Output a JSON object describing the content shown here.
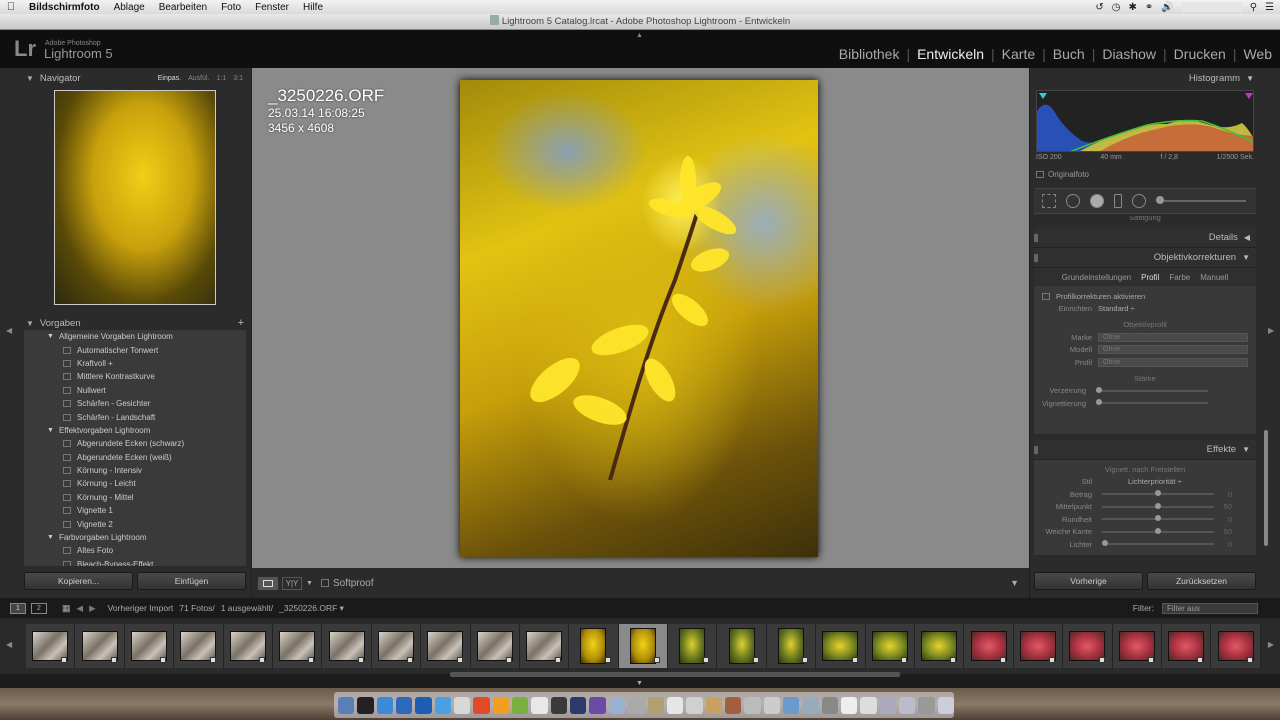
{
  "menubar": {
    "app": "Bildschirmfoto",
    "menus": [
      "Ablage",
      "Bearbeiten",
      "Foto",
      "Fenster",
      "Hilfe"
    ]
  },
  "window": {
    "title": "Lightroom 5 Catalog.lrcat - Adobe Photoshop Lightroom - Entwickeln"
  },
  "header": {
    "logo": "Lr",
    "product_small": "Adobe Photoshop",
    "product": "Lightroom 5",
    "modules": [
      "Bibliothek",
      "Entwickeln",
      "Karte",
      "Buch",
      "Diashow",
      "Drucken",
      "Web"
    ],
    "active_module": "Entwickeln"
  },
  "navigator": {
    "title": "Navigator",
    "zooms": [
      "Einpas.",
      "Ausfül.",
      "1:1",
      "3:1"
    ]
  },
  "presets": {
    "title": "Vorgaben",
    "add": "+",
    "groups": [
      {
        "name": "Allgemeine Vorgaben Lightroom",
        "items": [
          "Automatischer Tonwert",
          "Kraftvoll +",
          "Mittlere Kontrastkurve",
          "Nullwert",
          "Schärfen - Gesichter",
          "Schärfen - Landschaft"
        ]
      },
      {
        "name": "Effektvorgaben Lightroom",
        "items": [
          "Abgerundete Ecken (schwarz)",
          "Abgerundete Ecken (weiß)",
          "Körnung - Intensiv",
          "Körnung - Leicht",
          "Körnung - Mittel",
          "Vignette 1",
          "Vignette 2"
        ]
      },
      {
        "name": "Farbvorgaben Lightroom",
        "items": [
          "Altes Foto",
          "Bleach-Bypass-Effekt"
        ]
      }
    ]
  },
  "left_buttons": {
    "copy": "Kopieren...",
    "paste": "Einfügen"
  },
  "photo": {
    "filename": "_3250226.ORF",
    "datetime": "25.03.14 16:08:25",
    "dimensions": "3456 x 4608"
  },
  "toolbar": {
    "softproof": "Softproof"
  },
  "histogram": {
    "title": "Histogramm",
    "iso": "ISO 200",
    "focal": "40 mm",
    "aperture": "f / 2,8",
    "shutter": "1/2500 Sek.",
    "original": "Originalfoto"
  },
  "partial_label": "Sättigung",
  "details": {
    "title": "Details"
  },
  "lens": {
    "title": "Objektivkorrekturen",
    "tabs": [
      "Grundeinstellungen",
      "Profil",
      "Farbe",
      "Manuell"
    ],
    "active_tab": "Profil",
    "enable": "Profilkorrekturen aktivieren",
    "setup_label": "Einrichten",
    "setup_value": "Standard ÷",
    "profile_heading": "Objektivprofil",
    "make_label": "Marke",
    "make_value": "Ohne",
    "model_label": "Modell",
    "model_value": "Ohne",
    "profile_label": "Profil",
    "profile_value": "Ohne",
    "amount_heading": "Stärke",
    "distortion": "Verzerrung",
    "vignetting": "Vignettierung"
  },
  "effects": {
    "title": "Effekte",
    "heading": "Vignett. nach Freistellen",
    "style_label": "Stil",
    "style_value": "Lichterpriorität ÷",
    "amount": "Betrag",
    "amount_val": "0",
    "midpoint": "Mittelpunkt",
    "midpoint_val": "50",
    "roundness": "Rundheit",
    "roundness_val": "0",
    "feather": "Weiche Kante",
    "feather_val": "50",
    "highlights": "Lichter",
    "highlights_val": "0"
  },
  "right_buttons": {
    "previous": "Vorherige",
    "reset": "Zurücksetzen"
  },
  "filmstrip_bar": {
    "page1": "1",
    "page2": "2",
    "source": "Vorheriger Import",
    "count": "71 Fotos/",
    "selected": "1 ausgewählt/",
    "file": "_3250226.ORF ▾",
    "filter_label": "Filter:",
    "filter_value": "Filter aus"
  },
  "filmstrip": {
    "thumbs": [
      {
        "kind": "cat"
      },
      {
        "kind": "cat"
      },
      {
        "kind": "cat"
      },
      {
        "kind": "cat"
      },
      {
        "kind": "cat"
      },
      {
        "kind": "cat"
      },
      {
        "kind": "cat"
      },
      {
        "kind": "cat"
      },
      {
        "kind": "cat"
      },
      {
        "kind": "cat"
      },
      {
        "kind": "cat"
      },
      {
        "kind": "yellow-portrait"
      },
      {
        "kind": "yellow-portrait",
        "selected": true
      },
      {
        "kind": "green-portrait"
      },
      {
        "kind": "green-portrait"
      },
      {
        "kind": "green-portrait"
      },
      {
        "kind": "yellow-landscape"
      },
      {
        "kind": "yellow-landscape"
      },
      {
        "kind": "yellow-landscape"
      },
      {
        "kind": "red"
      },
      {
        "kind": "red"
      },
      {
        "kind": "red"
      },
      {
        "kind": "red"
      },
      {
        "kind": "red"
      },
      {
        "kind": "red"
      }
    ]
  },
  "colors": {
    "accent": "#eeeeee",
    "panel": "#2b2b2b",
    "center_bg": "#8a8a8a"
  }
}
